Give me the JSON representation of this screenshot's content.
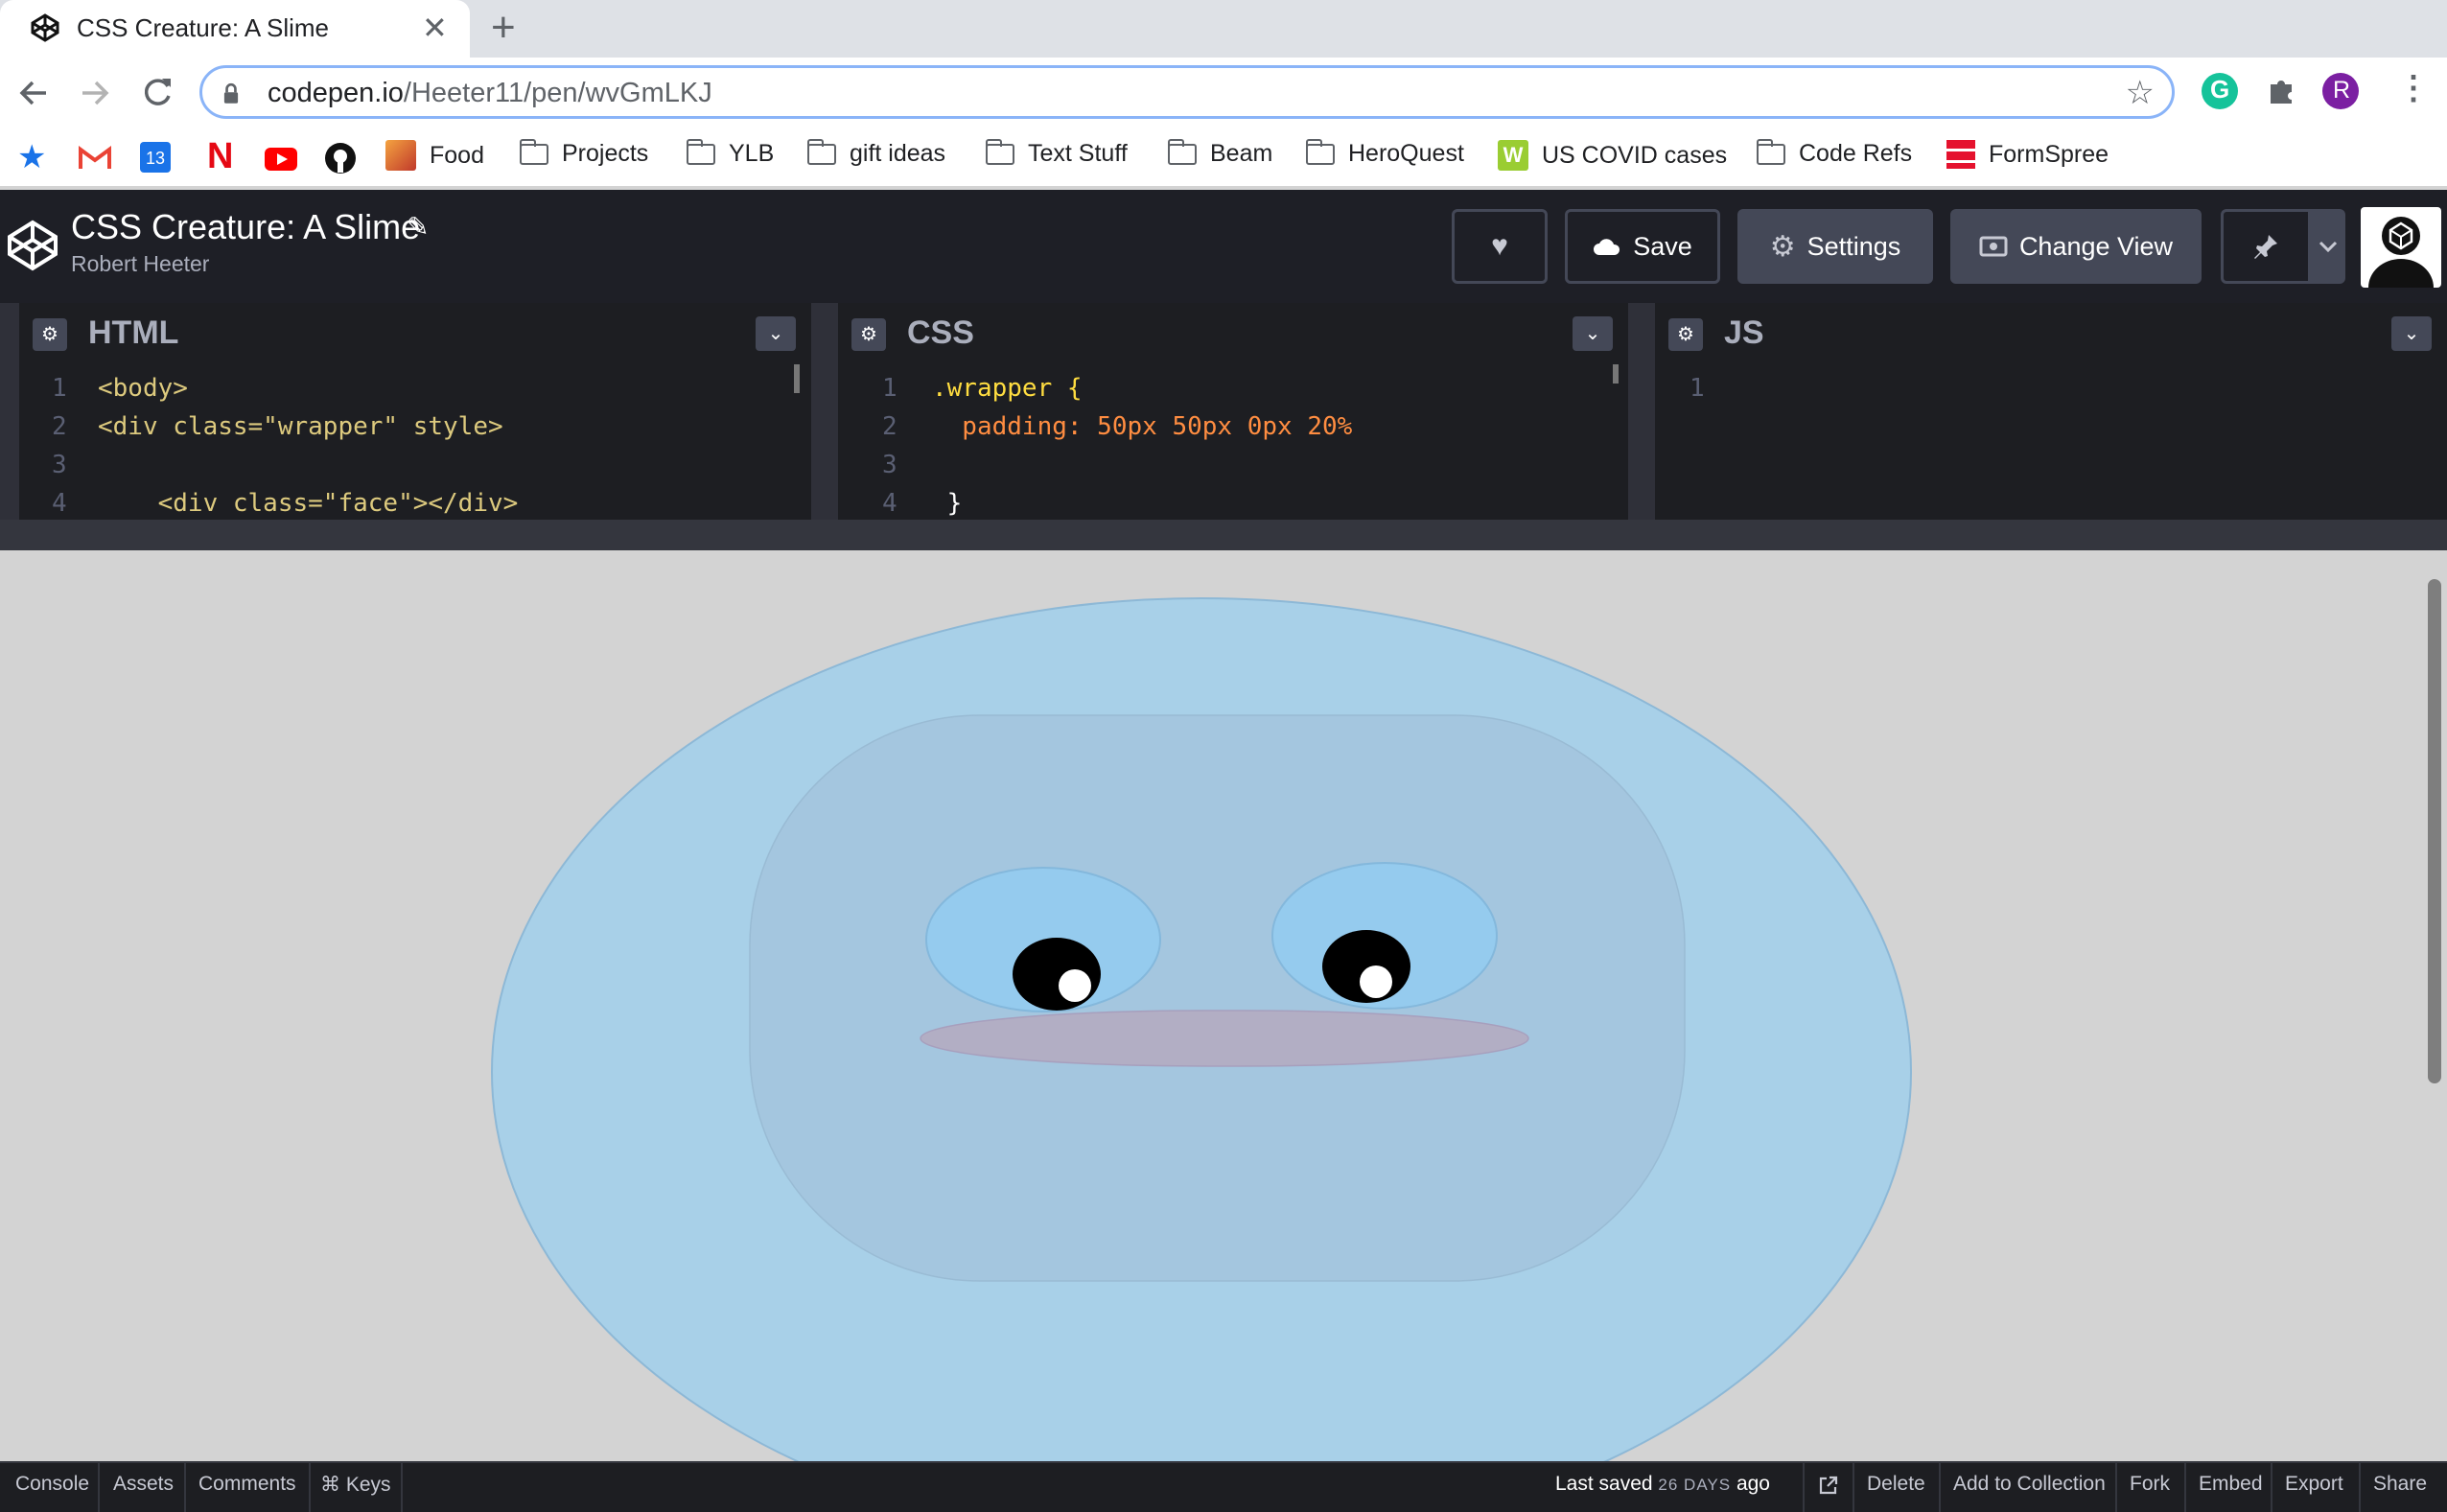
{
  "browser": {
    "tab_title": "CSS Creature: A Slime",
    "tab_close": "✕",
    "new_tab": "+",
    "url_host": "codepen.io",
    "url_path": "/Heeter11/pen/wvGmLKJ",
    "profile_initial": "R",
    "bookmarks": [
      {
        "label": "Food",
        "icon": "food-favicon"
      },
      {
        "label": "Projects",
        "icon": "folder-icon"
      },
      {
        "label": "YLB",
        "icon": "folder-icon"
      },
      {
        "label": "gift ideas",
        "icon": "folder-icon"
      },
      {
        "label": "Text Stuff",
        "icon": "folder-icon"
      },
      {
        "label": "Beam",
        "icon": "folder-icon"
      },
      {
        "label": "HeroQuest",
        "icon": "folder-icon"
      },
      {
        "label": "US COVID cases",
        "icon": "covid-favicon"
      },
      {
        "label": "Code Refs",
        "icon": "folder-icon"
      },
      {
        "label": "FormSpree",
        "icon": "formspree-favicon"
      }
    ],
    "calendar_day": "13"
  },
  "codepen": {
    "pen_title": "CSS Creature: A Slime",
    "author": "Robert Heeter",
    "buttons": {
      "save": "Save",
      "settings": "Settings",
      "change_view": "Change View"
    }
  },
  "editors": {
    "html": {
      "title": "HTML",
      "lines": [
        {
          "n": "1",
          "text": "<body>"
        },
        {
          "n": "2",
          "text": "<div class=\"wrapper\" style>"
        },
        {
          "n": "3",
          "text": ""
        },
        {
          "n": "4",
          "text": "    <div class=\"face\"></div>"
        }
      ]
    },
    "css": {
      "title": "CSS",
      "lines": [
        {
          "n": "1",
          "text": ".wrapper {"
        },
        {
          "n": "2",
          "text": "  padding: 50px 50px 0px 20%"
        },
        {
          "n": "3",
          "text": ""
        },
        {
          "n": "4",
          "text": " }"
        }
      ]
    },
    "js": {
      "title": "JS",
      "lines": [
        {
          "n": "1",
          "text": ""
        }
      ]
    }
  },
  "footer": {
    "left": [
      "Console",
      "Assets",
      "Comments",
      "⌘ Keys"
    ],
    "last_saved_prefix": "Last saved",
    "last_saved_value": "26 DAYS",
    "last_saved_suffix": "ago",
    "right": [
      "Delete",
      "Add to Collection",
      "Fork",
      "Embed",
      "Export",
      "Share"
    ]
  },
  "colors": {
    "slime_body": "#a8d0e8",
    "slime_inner": "#a4c6df",
    "slime_eye": "#95cbee",
    "slime_mouth": "#b2aec4",
    "codepen_header": "#1e1f26",
    "editor_bg": "#1d1e22"
  }
}
